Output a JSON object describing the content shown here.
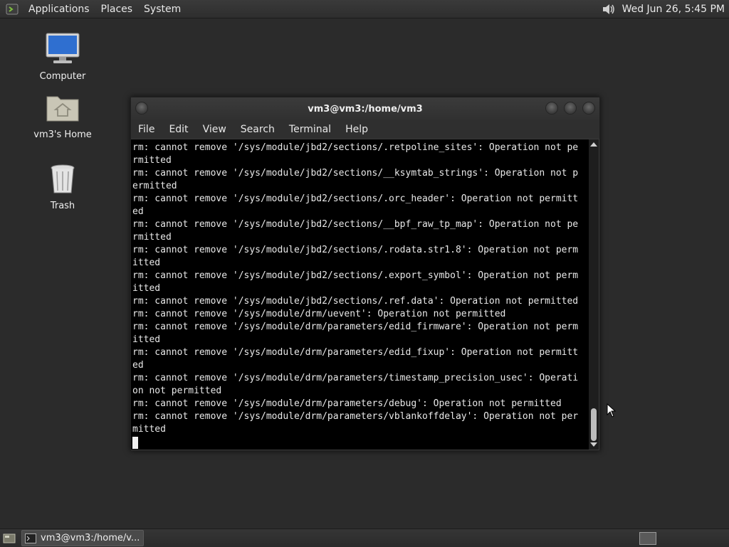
{
  "top_panel": {
    "menus": [
      "Applications",
      "Places",
      "System"
    ],
    "clock": "Wed Jun 26,  5:45 PM"
  },
  "desktop": {
    "icons": [
      {
        "label": "Computer",
        "icon": "computer-icon"
      },
      {
        "label": "vm3's Home",
        "icon": "home-folder-icon"
      },
      {
        "label": "Trash",
        "icon": "trash-icon"
      }
    ]
  },
  "terminal": {
    "title": "vm3@vm3:/home/vm3",
    "menu": [
      "File",
      "Edit",
      "View",
      "Search",
      "Terminal",
      "Help"
    ],
    "lines": [
      "rm: cannot remove '/sys/module/jbd2/sections/.retpoline_sites': Operation not pe",
      "rmitted",
      "rm: cannot remove '/sys/module/jbd2/sections/__ksymtab_strings': Operation not p",
      "ermitted",
      "rm: cannot remove '/sys/module/jbd2/sections/.orc_header': Operation not permitt",
      "ed",
      "rm: cannot remove '/sys/module/jbd2/sections/__bpf_raw_tp_map': Operation not pe",
      "rmitted",
      "rm: cannot remove '/sys/module/jbd2/sections/.rodata.str1.8': Operation not perm",
      "itted",
      "rm: cannot remove '/sys/module/jbd2/sections/.export_symbol': Operation not perm",
      "itted",
      "rm: cannot remove '/sys/module/jbd2/sections/.ref.data': Operation not permitted",
      "rm: cannot remove '/sys/module/drm/uevent': Operation not permitted",
      "rm: cannot remove '/sys/module/drm/parameters/edid_firmware': Operation not perm",
      "itted",
      "rm: cannot remove '/sys/module/drm/parameters/edid_fixup': Operation not permitt",
      "ed",
      "rm: cannot remove '/sys/module/drm/parameters/timestamp_precision_usec': Operati",
      "on not permitted",
      "rm: cannot remove '/sys/module/drm/parameters/debug': Operation not permitted",
      "rm: cannot remove '/sys/module/drm/parameters/vblankoffdelay': Operation not per",
      "mitted"
    ]
  },
  "bottom_panel": {
    "task_label": "vm3@vm3:/home/v..."
  }
}
